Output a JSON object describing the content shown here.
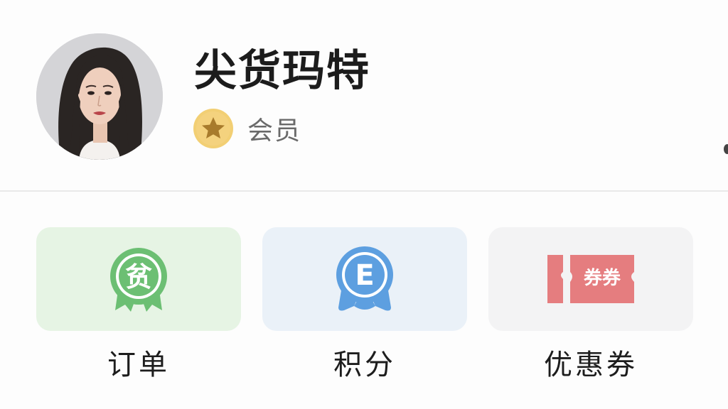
{
  "profile": {
    "name": "尖货玛特",
    "member_label": "会员",
    "avatar": "user-avatar-photo",
    "member_icon": "star-icon"
  },
  "shortcuts": [
    {
      "label": "订单",
      "icon": "order-badge-icon",
      "icon_text": "贫",
      "color": "#6cbf73",
      "bg": "#e6f4e4"
    },
    {
      "label": "积分",
      "icon": "points-badge-icon",
      "icon_text": "E",
      "color": "#5d9fe0",
      "bg": "#eaf1f8"
    },
    {
      "label": "优惠券",
      "icon": "coupon-ticket-icon",
      "icon_text": "券券",
      "color": "#e57d7f",
      "bg": "#f3f3f4"
    }
  ],
  "colors": {
    "star_badge": "#f2cf74",
    "star": "#a87b2c",
    "name_text": "#1c1c1c",
    "member_text": "#6a6a6a"
  }
}
